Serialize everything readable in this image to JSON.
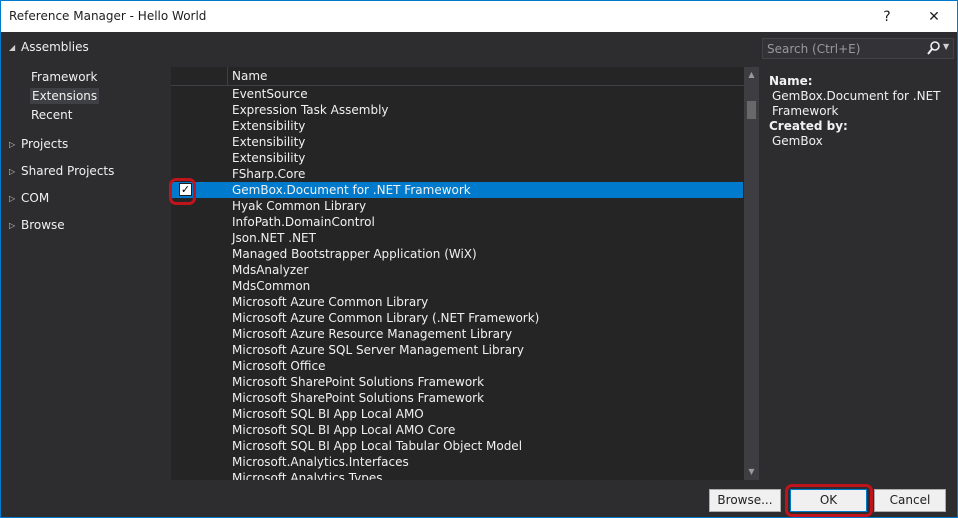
{
  "window": {
    "title": "Reference Manager - Hello World",
    "help_glyph": "?",
    "close_glyph": "✕"
  },
  "leftnav": {
    "assemblies": {
      "label": "Assemblies",
      "expanded": true
    },
    "assemblies_items": [
      {
        "label": "Framework",
        "selected": false
      },
      {
        "label": "Extensions",
        "selected": true
      },
      {
        "label": "Recent",
        "selected": false
      }
    ],
    "groups": [
      {
        "label": "Projects"
      },
      {
        "label": "Shared Projects"
      },
      {
        "label": "COM"
      },
      {
        "label": "Browse"
      }
    ]
  },
  "list": {
    "header_name": "Name",
    "rows": [
      {
        "name": "EventSource",
        "checked": false,
        "selected": false
      },
      {
        "name": "Expression Task Assembly",
        "checked": false,
        "selected": false
      },
      {
        "name": "Extensibility",
        "checked": false,
        "selected": false
      },
      {
        "name": "Extensibility",
        "checked": false,
        "selected": false
      },
      {
        "name": "Extensibility",
        "checked": false,
        "selected": false
      },
      {
        "name": "FSharp.Core",
        "checked": false,
        "selected": false
      },
      {
        "name": "GemBox.Document for .NET Framework",
        "checked": true,
        "selected": true
      },
      {
        "name": "Hyak Common Library",
        "checked": false,
        "selected": false
      },
      {
        "name": "InfoPath.DomainControl",
        "checked": false,
        "selected": false
      },
      {
        "name": "Json.NET .NET",
        "checked": false,
        "selected": false
      },
      {
        "name": "Managed Bootstrapper Application (WiX)",
        "checked": false,
        "selected": false
      },
      {
        "name": "MdsAnalyzer",
        "checked": false,
        "selected": false
      },
      {
        "name": "MdsCommon",
        "checked": false,
        "selected": false
      },
      {
        "name": "Microsoft Azure Common Library",
        "checked": false,
        "selected": false
      },
      {
        "name": "Microsoft Azure Common Library (.NET Framework)",
        "checked": false,
        "selected": false
      },
      {
        "name": "Microsoft Azure Resource Management Library",
        "checked": false,
        "selected": false
      },
      {
        "name": "Microsoft Azure SQL Server Management Library",
        "checked": false,
        "selected": false
      },
      {
        "name": "Microsoft Office",
        "checked": false,
        "selected": false
      },
      {
        "name": "Microsoft SharePoint Solutions Framework",
        "checked": false,
        "selected": false
      },
      {
        "name": "Microsoft SharePoint Solutions Framework",
        "checked": false,
        "selected": false
      },
      {
        "name": "Microsoft SQL BI App Local AMO",
        "checked": false,
        "selected": false
      },
      {
        "name": "Microsoft SQL BI App Local AMO Core",
        "checked": false,
        "selected": false
      },
      {
        "name": "Microsoft SQL BI App Local Tabular Object Model",
        "checked": false,
        "selected": false
      },
      {
        "name": "Microsoft.Analytics.Interfaces",
        "checked": false,
        "selected": false
      },
      {
        "name": "Microsoft.Analytics.Types",
        "checked": false,
        "selected": false
      }
    ]
  },
  "search": {
    "placeholder": "Search (Ctrl+E)",
    "value": ""
  },
  "details": {
    "name_label": "Name:",
    "name_value_line1": "GemBox.Document for .NET",
    "name_value_line2": "Framework",
    "created_label": "Created by:",
    "created_value": "GemBox"
  },
  "buttons": {
    "browse": "Browse...",
    "ok": "OK",
    "cancel": "Cancel"
  },
  "colors": {
    "accent": "#007acc",
    "background": "#2d2d30",
    "list_bg": "#252526",
    "highlight_ring": "#c0141c"
  }
}
